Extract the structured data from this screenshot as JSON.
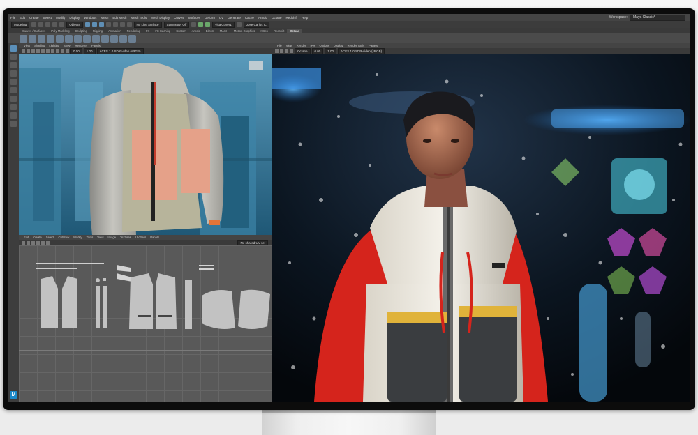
{
  "app": {
    "menus": [
      "File",
      "Edit",
      "Create",
      "Select",
      "Modify",
      "Display",
      "Windows",
      "Mesh",
      "Edit Mesh",
      "Mesh Tools",
      "Mesh Display",
      "Curves",
      "Surfaces",
      "Deform",
      "UV",
      "Generate",
      "Cache",
      "Arnold",
      "Octane",
      "Redshift",
      "Help"
    ],
    "workspace_label": "Workspace:",
    "workspace_value": "Maya Classic*"
  },
  "statusline": {
    "mode": "Modeling",
    "objects": "Objects",
    "live_surface": "No Live Surface",
    "symmetry": "Symmetry: Off",
    "renderer_field": "visalCover1",
    "user": "Jose Carlos C."
  },
  "shelf_tabs": [
    "Curves / Surfaces",
    "Poly Modeling",
    "Sculpting",
    "Rigging",
    "Animation",
    "Rendering",
    "FX",
    "FX Caching",
    "Custom",
    "Arnold",
    "Bifrost",
    "MASH",
    "Motion Graphics",
    "XGen",
    "Redshift",
    "Octane"
  ],
  "shelf_active_tab": "Octane",
  "viewport_left": {
    "menu": [
      "View",
      "Shading",
      "Lighting",
      "Show",
      "Renderer",
      "Panels"
    ],
    "camera_value": "0.00",
    "gamma_value": "1.00",
    "color_space": "ACES 1.0 SDR-video (sRGB)"
  },
  "uv_editor": {
    "menu": [
      "Edit",
      "Create",
      "Select",
      "Cut/Sew",
      "Modify",
      "Tools",
      "View",
      "Image",
      "Textures",
      "UV Sets",
      "Panels"
    ],
    "uv_set": "No shared UV set"
  },
  "viewport_right": {
    "menu": [
      "File",
      "View",
      "Render",
      "IPR",
      "Options",
      "Display",
      "Render Tools",
      "Panels"
    ],
    "camera": "Octane",
    "exposure_value": "0.00",
    "gamma_value": "1.00",
    "color_space": "ACES 1.0 SDR-video (sRGB)"
  },
  "toolbox_logo": "M",
  "colors": {
    "accent": "#5b8fb8",
    "maya_logo": "#1c89c8",
    "jacket_red": "#d5241c",
    "jacket_yellow": "#e0b33a",
    "viewport_blue": "#2e6f8e"
  }
}
